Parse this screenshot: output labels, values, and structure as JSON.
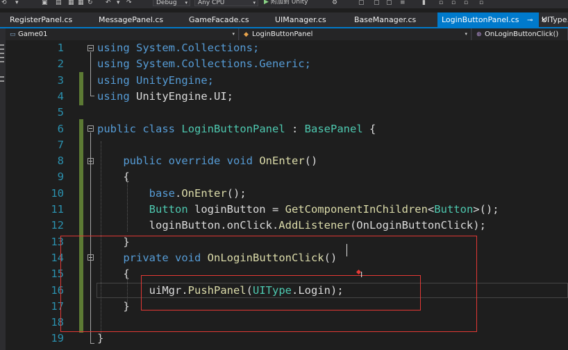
{
  "toolbar": {
    "config_value": "Debug",
    "platform_value": "Any CPU",
    "attach_label": "附加到 Unity"
  },
  "tabs": [
    {
      "label": "RegisterPanel.cs"
    },
    {
      "label": "MessagePanel.cs"
    },
    {
      "label": "GameFacade.cs"
    },
    {
      "label": "UIManager.cs"
    },
    {
      "label": "BaseManager.cs"
    },
    {
      "label": "LoginButtonPanel.cs",
      "active": true
    },
    {
      "label": "UIType."
    }
  ],
  "navbar": {
    "project": "Game01",
    "class": "LoginButtonPanel",
    "member": "OnLoginButtonClick()"
  },
  "editor": {
    "line_numbers": [
      "1",
      "2",
      "3",
      "4",
      "5",
      "6",
      "7",
      "8",
      "9",
      "10",
      "11",
      "12",
      "13",
      "14",
      "15",
      "16",
      "17",
      "18",
      "19"
    ],
    "lines": [
      [
        {
          "t": "using",
          "c": "kw"
        },
        {
          "t": " System.Collections;",
          "c": "kw"
        }
      ],
      [
        {
          "t": "using",
          "c": "kw"
        },
        {
          "t": " System.Collections.Generic;",
          "c": "kw"
        }
      ],
      [
        {
          "t": "using",
          "c": "kw"
        },
        {
          "t": " UnityEngine;",
          "c": "kw"
        }
      ],
      [
        {
          "t": "using",
          "c": "kw"
        },
        {
          "t": " UnityEngine.UI;",
          "c": ""
        }
      ],
      [],
      [
        {
          "t": "public",
          "c": "kw"
        },
        {
          "t": " "
        },
        {
          "t": "class",
          "c": "kw"
        },
        {
          "t": " "
        },
        {
          "t": "LoginButtonPanel",
          "c": "ty"
        },
        {
          "t": " : "
        },
        {
          "t": "BasePanel",
          "c": "ty"
        },
        {
          "t": " {"
        }
      ],
      [],
      [
        {
          "t": "    "
        },
        {
          "t": "public",
          "c": "kw"
        },
        {
          "t": " "
        },
        {
          "t": "override",
          "c": "kw"
        },
        {
          "t": " "
        },
        {
          "t": "void",
          "c": "kw"
        },
        {
          "t": " "
        },
        {
          "t": "OnEnter",
          "c": "fn"
        },
        {
          "t": "()"
        }
      ],
      [
        {
          "t": "    {"
        }
      ],
      [
        {
          "t": "        "
        },
        {
          "t": "base",
          "c": "kw"
        },
        {
          "t": "."
        },
        {
          "t": "OnEnter",
          "c": "fn"
        },
        {
          "t": "();"
        }
      ],
      [
        {
          "t": "        "
        },
        {
          "t": "Button",
          "c": "ty"
        },
        {
          "t": " loginButton = "
        },
        {
          "t": "GetComponentInChildren",
          "c": "fn"
        },
        {
          "t": "<"
        },
        {
          "t": "Button",
          "c": "ty"
        },
        {
          "t": ">();"
        }
      ],
      [
        {
          "t": "        loginButton.onClick."
        },
        {
          "t": "AddListener",
          "c": "fn"
        },
        {
          "t": "(OnLoginButtonClick);"
        }
      ],
      [
        {
          "t": "    }"
        }
      ],
      [
        {
          "t": "    "
        },
        {
          "t": "private",
          "c": "kw"
        },
        {
          "t": " "
        },
        {
          "t": "void",
          "c": "kw"
        },
        {
          "t": " "
        },
        {
          "t": "OnLoginButtonClick",
          "c": "fn"
        },
        {
          "t": "()"
        }
      ],
      [
        {
          "t": "    {"
        }
      ],
      [
        {
          "t": "        uiMgr."
        },
        {
          "t": "PushPanel",
          "c": "fn"
        },
        {
          "t": "("
        },
        {
          "t": "UIType",
          "c": "ty"
        },
        {
          "t": ".Login);"
        }
      ],
      [
        {
          "t": "    }"
        }
      ],
      [],
      [
        {
          "t": "}"
        }
      ]
    ]
  }
}
